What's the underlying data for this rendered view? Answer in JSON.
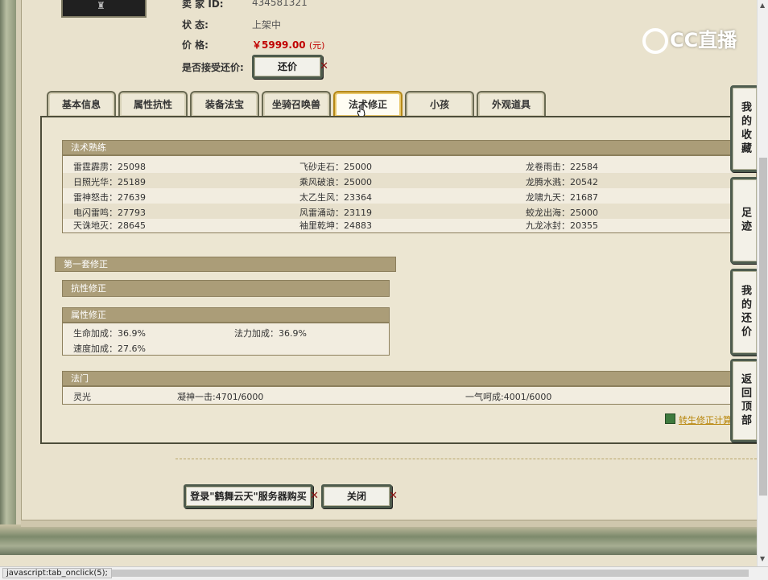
{
  "seller": {
    "id_label": "卖 家 ID:",
    "id_value": "434581321",
    "status_label": "状    态:",
    "status_value": "上架中",
    "price_label": "价    格:",
    "price_value": "￥5999.00",
    "price_unit": "(元)",
    "counter_label": "是否接受还价:",
    "counter_button": "还价"
  },
  "logo": {
    "text": "CC直播"
  },
  "tabs": [
    {
      "label": "基本信息"
    },
    {
      "label": "属性抗性"
    },
    {
      "label": "装备法宝"
    },
    {
      "label": "坐骑召唤兽"
    },
    {
      "label": "法术修正",
      "active": true
    },
    {
      "label": "小孩"
    },
    {
      "label": "外观道具"
    }
  ],
  "spell_mastery": {
    "title": "法术熟练",
    "rows": [
      [
        "雷霆霹雳：25098",
        "飞砂走石：25000",
        "龙卷雨击：22584"
      ],
      [
        "日照光华：25189",
        "乘风破浪：25000",
        "龙腾水溅：20542"
      ],
      [
        "雷神怒击：27639",
        "太乙生风：23364",
        "龙啸九天：21687"
      ],
      [
        "电闪雷鸣：27793",
        "风雷涌动：23119",
        "蛟龙出海：25000"
      ],
      [
        "天诛地灭：28645",
        "袖里乾坤：24883",
        "九龙冰封：20355"
      ]
    ]
  },
  "first_set": {
    "title": "第一套修正",
    "resist_title": "抗性修正",
    "attr_title": "属性修正",
    "attr_rows": [
      [
        "生命加成：36.9%",
        "法力加成：36.9%"
      ],
      [
        "速度加成：27.6%",
        ""
      ]
    ]
  },
  "fa_men": {
    "title": "法门",
    "row": [
      "灵光",
      "凝神一击:4701/6000",
      "一气呵成:4001/6000"
    ]
  },
  "calc_link": "转生修正计算",
  "bottom_buttons": {
    "login_buy": "登录\"鹤舞云天\"服务器购买",
    "close": "关闭"
  },
  "side_nav": [
    "我的收藏",
    "足迹",
    "我的还价",
    "返回顶部"
  ],
  "status_bar": "javascript:tab_onclick(5);",
  "colors": {
    "section_header": "#ab9d78",
    "price": "#c00000",
    "active_tab_border": "#b58818"
  }
}
